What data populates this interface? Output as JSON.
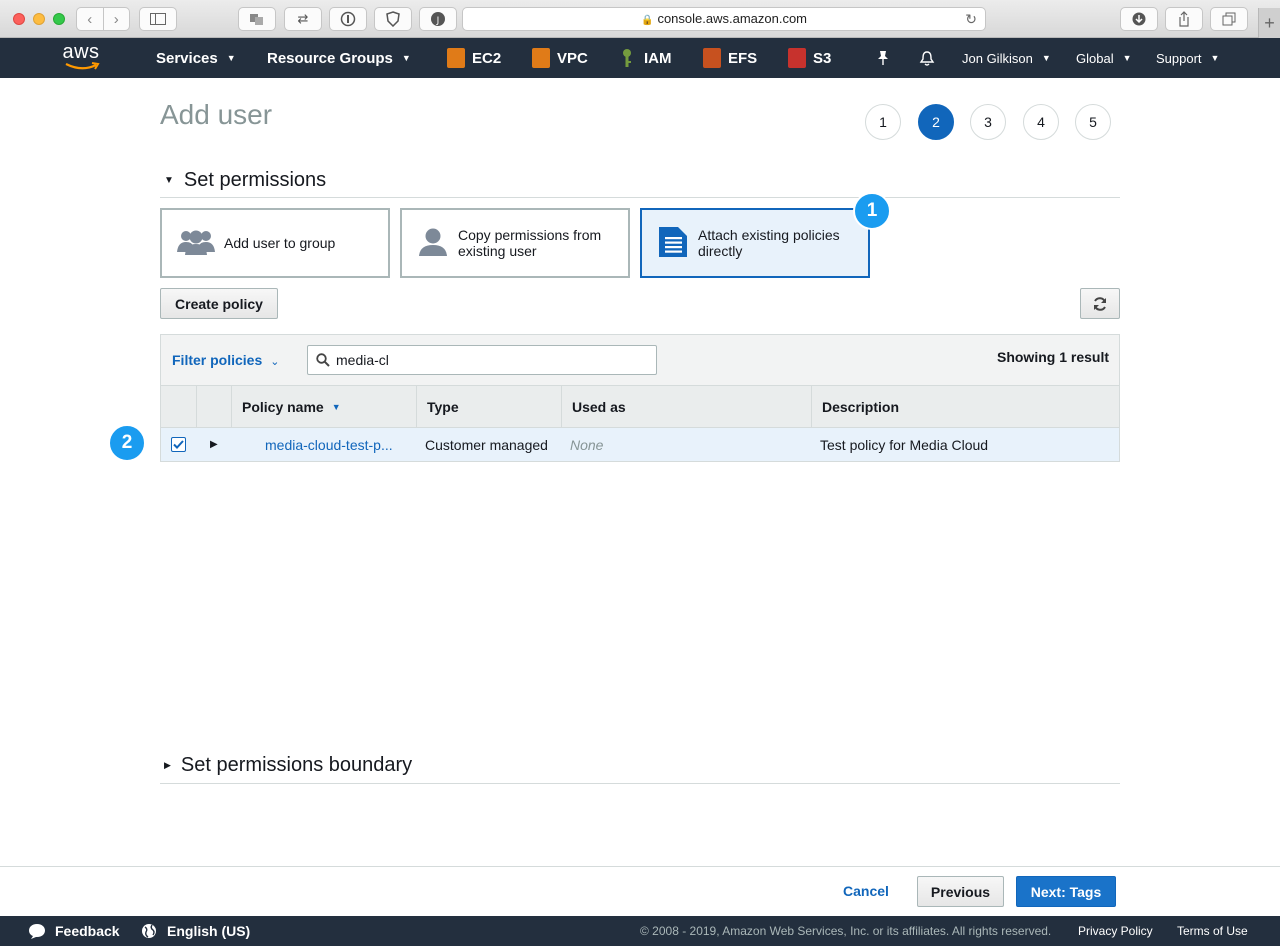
{
  "browser": {
    "url": "console.aws.amazon.com"
  },
  "nav": {
    "logo_text": "aws",
    "services_label": "Services",
    "resource_groups_label": "Resource Groups",
    "shortcuts": [
      {
        "label": "EC2",
        "color": "#e07b18"
      },
      {
        "label": "VPC",
        "color": "#e07b18"
      },
      {
        "label": "IAM",
        "color": "#759c3e"
      },
      {
        "label": "EFS",
        "color": "#c7511f"
      },
      {
        "label": "S3",
        "color": "#c7322d"
      }
    ],
    "user_label": "Jon Gilkison",
    "region_label": "Global",
    "support_label": "Support"
  },
  "page": {
    "title": "Add user",
    "steps": [
      "1",
      "2",
      "3",
      "4",
      "5"
    ],
    "active_step": "2"
  },
  "permissions": {
    "section_title": "Set permissions",
    "options": [
      {
        "label": "Add user to group",
        "icon": "group-icon"
      },
      {
        "label": "Copy permissions from existing user",
        "icon": "user-icon"
      },
      {
        "label": "Attach existing policies directly",
        "icon": "document-icon",
        "selected": true
      }
    ],
    "badge_1": "1",
    "badge_2": "2",
    "create_policy_label": "Create policy"
  },
  "table": {
    "filter_label": "Filter policies",
    "search_value": "media-cl",
    "result_count": "Showing 1 result",
    "columns": [
      "Policy name",
      "Type",
      "Used as",
      "Description"
    ],
    "rows": [
      {
        "checked": true,
        "policy_name": "media-cloud-test-p...",
        "type": "Customer managed",
        "used_as": "None",
        "description": "Test policy for Media Cloud"
      }
    ]
  },
  "boundary": {
    "section_title": "Set permissions boundary"
  },
  "actions": {
    "cancel_label": "Cancel",
    "previous_label": "Previous",
    "next_label": "Next: Tags"
  },
  "footer": {
    "feedback_label": "Feedback",
    "language_label": "English (US)",
    "copyright": "© 2008 - 2019, Amazon Web Services, Inc. or its affiliates. All rights reserved.",
    "privacy_label": "Privacy Policy",
    "terms_label": "Terms of Use"
  }
}
